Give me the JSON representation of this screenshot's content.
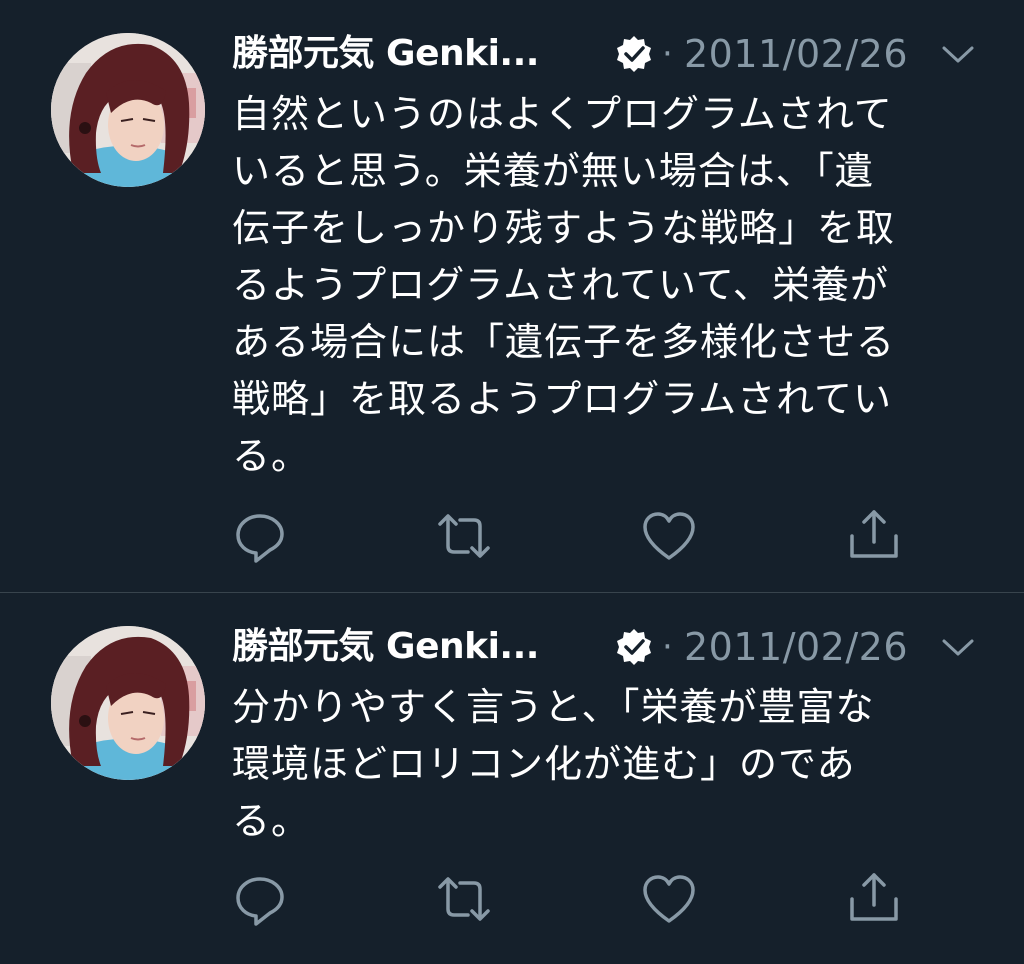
{
  "tweets": [
    {
      "author": "勝部元気 Genki...",
      "separator": "·",
      "date": "2011/02/26",
      "text": "自然というのはよくプログラムされて\nいると思う。栄養が無い場合は、「遺\n伝子をしっかり残すような戦略」を取\nるようプログラムされていて、栄養が\nある場合には「遺伝子を多様化させる\n戦略」を取るようプログラムされてい\nる。"
    },
    {
      "author": "勝部元気 Genki...",
      "separator": "·",
      "date": "2011/02/26",
      "text": "分かりやすく言うと、「栄養が豊富な\n環境ほどロリコン化が進む」のであ\nる。"
    }
  ],
  "icons": {
    "verified": "verified-badge-icon",
    "caret": "chevron-down-icon",
    "reply": "reply-icon",
    "retweet": "retweet-icon",
    "like": "heart-icon",
    "share": "share-icon"
  },
  "colors": {
    "background": "#15202b",
    "text": "#ffffff",
    "secondary": "#8899a6",
    "divider": "#38444d"
  }
}
